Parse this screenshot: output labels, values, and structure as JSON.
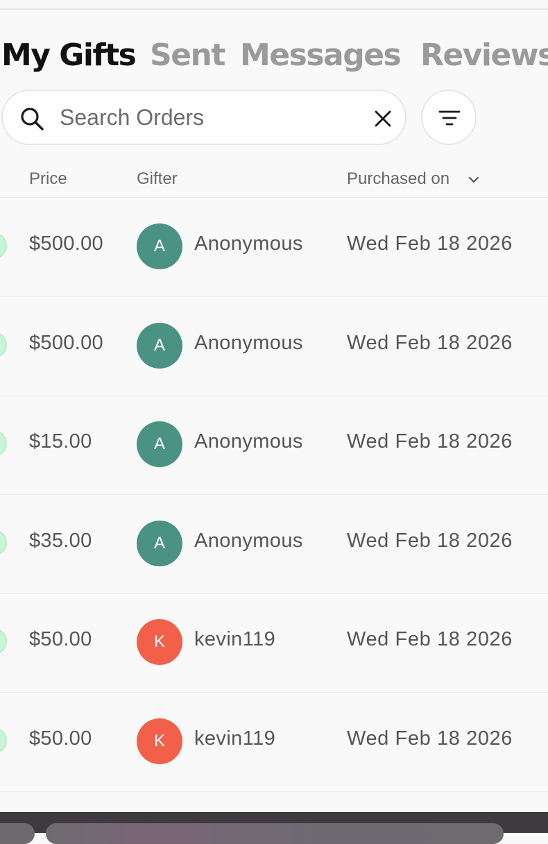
{
  "tabs": [
    {
      "label": "My Gifts",
      "active": true
    },
    {
      "label": "Sent",
      "active": false
    },
    {
      "label": "Messages",
      "active": false
    },
    {
      "label": "Reviews",
      "active": false
    }
  ],
  "search": {
    "placeholder": "Search Orders",
    "value": ""
  },
  "table": {
    "columns": {
      "price": "Price",
      "gifter": "Gifter",
      "purchased_on": "Purchased on"
    },
    "rows": [
      {
        "price": "$500.00",
        "gifter_initial": "A",
        "gifter": "Anonymous",
        "date": "Wed Feb 18 2026"
      },
      {
        "price": "$500.00",
        "gifter_initial": "A",
        "gifter": "Anonymous",
        "date": "Wed Feb 18 2026"
      },
      {
        "price": "$15.00",
        "gifter_initial": "A",
        "gifter": "Anonymous",
        "date": "Wed Feb 18 2026"
      },
      {
        "price": "$35.00",
        "gifter_initial": "A",
        "gifter": "Anonymous",
        "date": "Wed Feb 18 2026"
      },
      {
        "price": "$50.00",
        "gifter_initial": "K",
        "gifter": "kevin119",
        "date": "Wed Feb 18 2026"
      },
      {
        "price": "$50.00",
        "gifter_initial": "K",
        "gifter": "kevin119",
        "date": "Wed Feb 18 2026"
      }
    ]
  },
  "colors": {
    "avatar_anonymous": "#4a9384",
    "avatar_kevin": "#f2604a",
    "status_dot": "#c8f5d6",
    "active_tab": "#111111",
    "inactive_tab": "#9a9a9a"
  },
  "icons": {
    "search": "search-icon",
    "clear": "close-icon",
    "filter": "filter-icon",
    "sort": "chevron-down-icon"
  }
}
